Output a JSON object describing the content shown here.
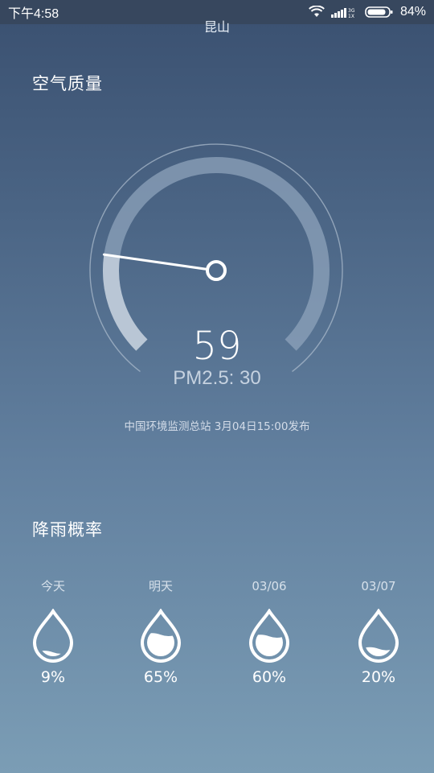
{
  "status_bar": {
    "time": "下午4:58",
    "battery_percent": "84%",
    "icons": [
      "wifi-icon",
      "signal-icon",
      "battery-icon"
    ]
  },
  "city": "昆山",
  "air_quality": {
    "title": "空气质量",
    "aqi": "59",
    "aqi_numeric": 59,
    "pm25": "PM2.5: 30",
    "source": "中国环境监测总站 3月04日15:00发布"
  },
  "rain": {
    "title": "降雨概率",
    "days": [
      {
        "label": "今天",
        "percent": "9%",
        "value": 0.09
      },
      {
        "label": "明天",
        "percent": "65%",
        "value": 0.65
      },
      {
        "label": "03/06",
        "percent": "60%",
        "value": 0.6
      },
      {
        "label": "03/07",
        "percent": "20%",
        "value": 0.2
      }
    ]
  },
  "colors": {
    "status_bar": "#37475e",
    "gauge_track": "#8ea3bb",
    "gauge_outer": "#9fb2c6"
  }
}
